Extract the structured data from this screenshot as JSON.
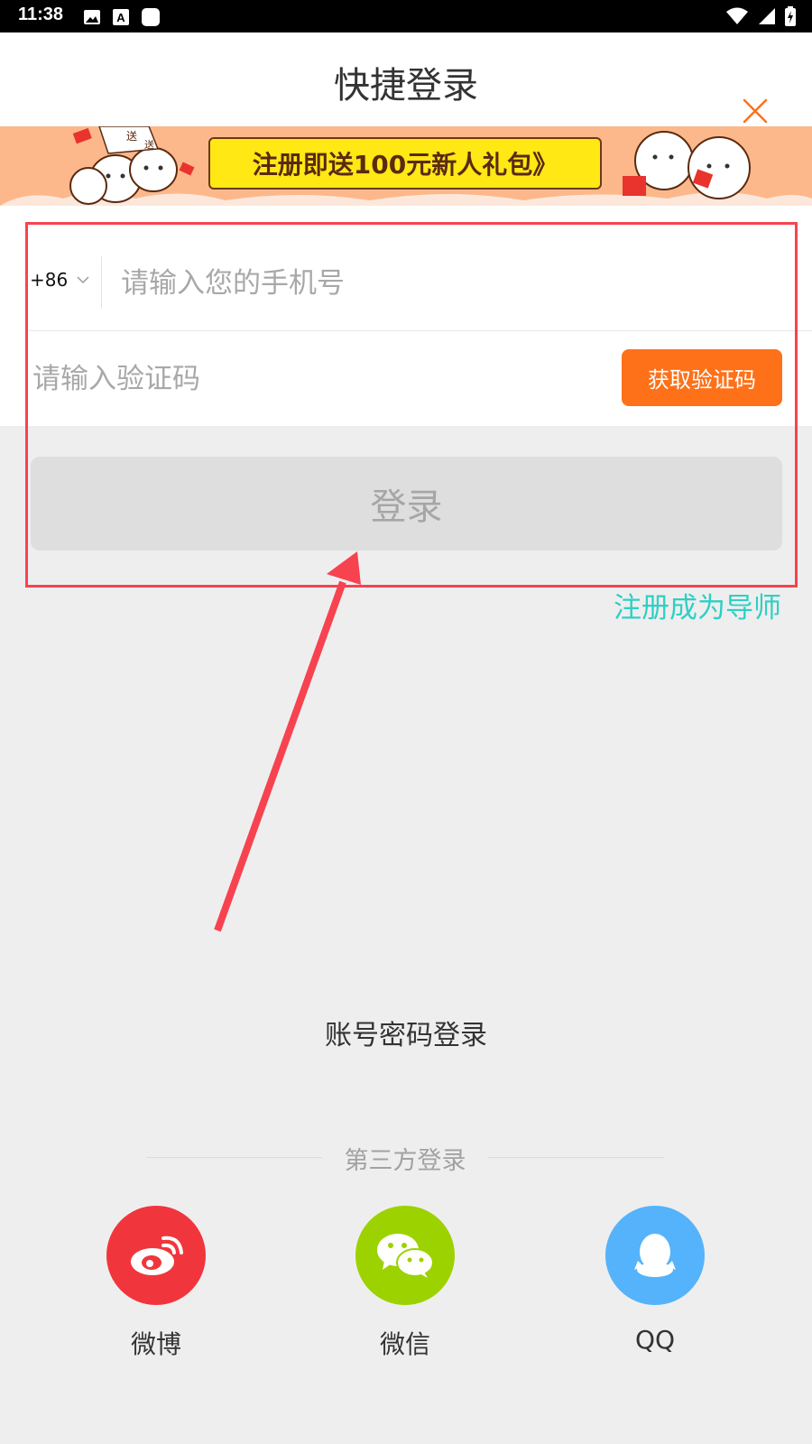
{
  "status_bar": {
    "time": "11:38",
    "icons_left": [
      "image-icon",
      "font-a-icon",
      "app-icon"
    ],
    "icons_right": [
      "wifi-icon",
      "signal-icon",
      "battery-charging-icon"
    ]
  },
  "header": {
    "title": "快捷登录",
    "close_icon": "close-icon",
    "accent_color": "#fe7119"
  },
  "banner": {
    "text": "注册即送100元新人礼包》",
    "background": "#fcb88b",
    "button_color": "#ffe814"
  },
  "form": {
    "country_code": "+86",
    "phone_placeholder": "请输入您的手机号",
    "code_placeholder": "请输入验证码",
    "get_code_label": "获取验证码",
    "login_label": "登录",
    "register_link": "注册成为导师"
  },
  "account_login": "账号密码登录",
  "third_party": {
    "label": "第三方登录",
    "providers": [
      {
        "name": "微博",
        "icon": "weibo-icon",
        "color": "#f0363c"
      },
      {
        "name": "微信",
        "icon": "wechat-icon",
        "color": "#9cd200"
      },
      {
        "name": "QQ",
        "icon": "qq-icon",
        "color": "#54b3fb"
      }
    ]
  },
  "annotation": {
    "box_color": "#f7434f",
    "arrow_color": "#f7434f"
  }
}
